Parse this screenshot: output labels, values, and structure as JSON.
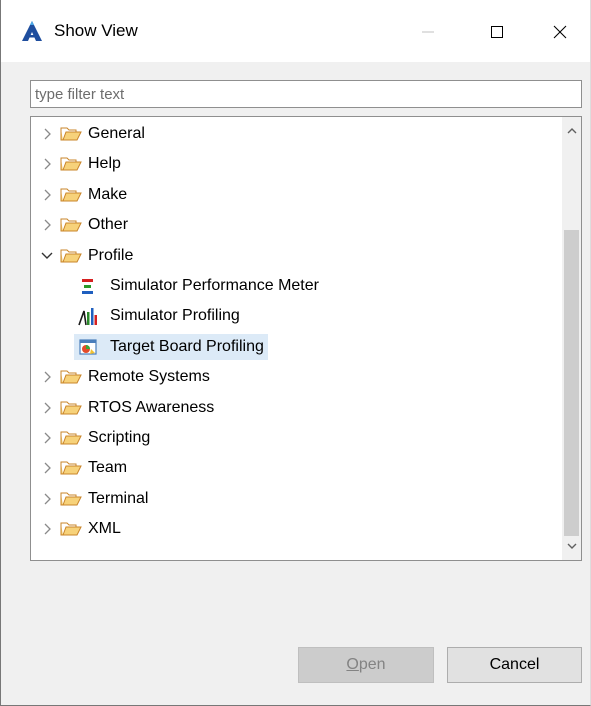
{
  "window": {
    "title": "Show View",
    "app_icon": "eclipse-a-logo",
    "controls": [
      "minimize",
      "maximize",
      "close"
    ]
  },
  "filter": {
    "placeholder": "type filter text",
    "value": ""
  },
  "tree": {
    "items": [
      {
        "label": "General",
        "icon": "folder-icon",
        "expanded": false
      },
      {
        "label": "Help",
        "icon": "folder-icon",
        "expanded": false
      },
      {
        "label": "Make",
        "icon": "folder-icon",
        "expanded": false
      },
      {
        "label": "Other",
        "icon": "folder-icon",
        "expanded": false
      },
      {
        "label": "Profile",
        "icon": "folder-icon",
        "expanded": true
      },
      {
        "label": "Simulator Performance Meter",
        "icon": "performance-meter-icon",
        "child": true
      },
      {
        "label": "Simulator Profiling",
        "icon": "simulator-profiling-icon",
        "child": true
      },
      {
        "label": "Target Board Profiling",
        "icon": "target-board-profiling-icon",
        "child": true,
        "selected": true
      },
      {
        "label": "Remote Systems",
        "icon": "folder-icon",
        "expanded": false
      },
      {
        "label": "RTOS Awareness",
        "icon": "folder-icon",
        "expanded": false
      },
      {
        "label": "Scripting",
        "icon": "folder-icon",
        "expanded": false
      },
      {
        "label": "Team",
        "icon": "folder-icon",
        "expanded": false
      },
      {
        "label": "Terminal",
        "icon": "folder-icon",
        "expanded": false
      },
      {
        "label": "XML",
        "icon": "folder-icon",
        "expanded": false
      }
    ]
  },
  "buttons": {
    "open_mnemonic": "O",
    "open_rest": "pen",
    "open_enabled": false,
    "cancel_label": "Cancel"
  },
  "colors": {
    "selection": "#dceaf7",
    "folder": "#e8a33c",
    "accent": "#0078d7"
  }
}
